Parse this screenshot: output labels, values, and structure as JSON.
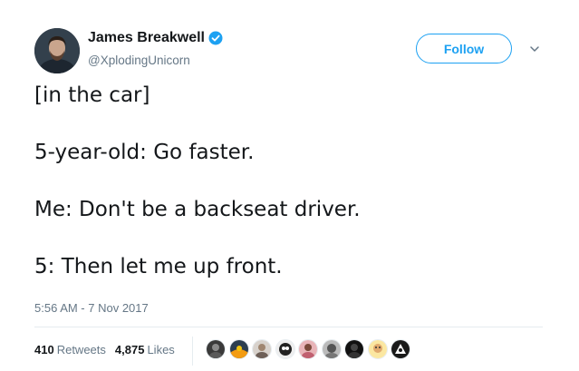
{
  "author": {
    "name": "James Breakwell",
    "handle": "@XplodingUnicorn",
    "verified": true
  },
  "follow_button_label": "Follow",
  "tweet": {
    "lines": [
      "[in the car]",
      "5-year-old: Go faster.",
      "Me: Don't be a backseat driver.",
      "5: Then let me up front."
    ],
    "timestamp": "5:56 AM - 7 Nov 2017"
  },
  "stats": {
    "retweets_count": "410",
    "retweets_label": "Retweets",
    "likes_count": "4,875",
    "likes_label": "Likes"
  },
  "likers": [
    {
      "icon": "liker-avatar-1"
    },
    {
      "icon": "liker-avatar-2"
    },
    {
      "icon": "liker-avatar-3"
    },
    {
      "icon": "liker-avatar-4"
    },
    {
      "icon": "liker-avatar-5"
    },
    {
      "icon": "liker-avatar-6"
    },
    {
      "icon": "liker-avatar-7"
    },
    {
      "icon": "liker-avatar-8"
    },
    {
      "icon": "liker-avatar-9"
    }
  ],
  "colors": {
    "accent": "#1da1f2",
    "text": "#14171a",
    "secondary": "#657786",
    "divider": "#e6ecf0"
  }
}
